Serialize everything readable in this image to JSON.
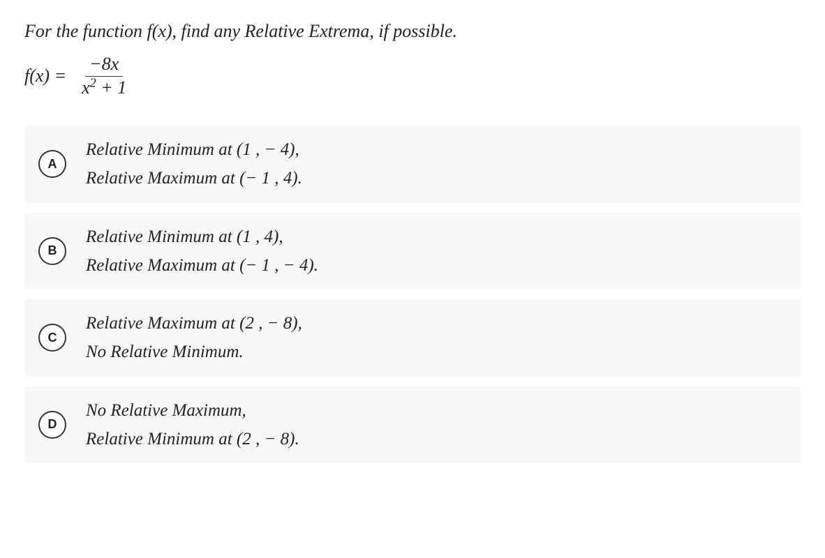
{
  "question": {
    "prompt": "For the function f(x), find any Relative Extrema, if possible.",
    "func_lhs": "f(x) =",
    "func_num": "−8x",
    "func_den_x": "x",
    "func_den_exp": "2",
    "func_den_rest": " + 1"
  },
  "options": [
    {
      "letter": "A",
      "line1": "Relative Minimum at (1 , − 4),",
      "line2": "Relative Maximum at (− 1 , 4)."
    },
    {
      "letter": "B",
      "line1": "Relative Minimum at (1 , 4),",
      "line2": "Relative Maximum at (− 1 , − 4)."
    },
    {
      "letter": "C",
      "line1": "Relative Maximum at (2 , − 8),",
      "line2": "No Relative Minimum."
    },
    {
      "letter": "D",
      "line1": "No Relative Maximum,",
      "line2": "Relative Minimum at (2 , − 8)."
    }
  ]
}
